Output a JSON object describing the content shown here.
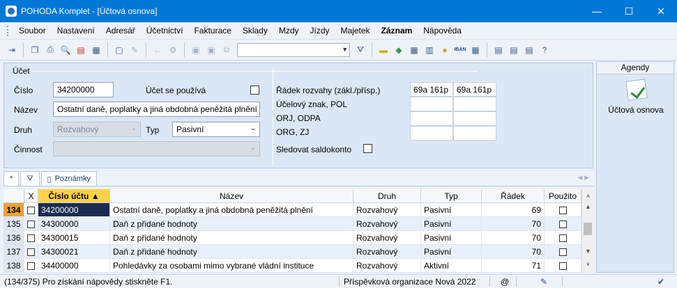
{
  "window": {
    "title": "POHODA Komplet - [Účtová osnova]",
    "minimize": "—",
    "maximize": "☐",
    "close": "✕"
  },
  "menu": [
    "Soubor",
    "Nastavení",
    "Adresář",
    "Účetnictví",
    "Fakturace",
    "Sklady",
    "Mzdy",
    "Jízdy",
    "Majetek",
    "Záznam",
    "Nápověda"
  ],
  "toolbar": {
    "iban_label": "IBAN"
  },
  "form": {
    "group_label": "Účet",
    "cislo_label": "Číslo",
    "cislo_value": "34200000",
    "pouziva_label": "Účet se používá",
    "nazev_label": "Název",
    "nazev_value": "Ostatní daně, poplatky a jiná obdobná peněžitá plnění",
    "druh_label": "Druh",
    "druh_value": "Rozvahový",
    "typ_label": "Typ",
    "typ_value": "Pasivní",
    "cinnost_label": "Činnost",
    "radek_label": "Řádek rozvahy (zákl./přísp.)",
    "radek_value1": "69a 161p",
    "radek_value2": "69a 161p",
    "ucelovy_label": "Účelový znak, POL",
    "orj_label": "ORJ, ODPA",
    "org_label": "ORG, ZJ",
    "saldo_label": "Sledovat saldokonto"
  },
  "agenda": {
    "header": "Agendy",
    "item_label": "Účtová osnova"
  },
  "tabs": {
    "star": "*",
    "filter_icon": "filter-icon",
    "notes": "Poznámky"
  },
  "table": {
    "columns": [
      "",
      "X",
      "Číslo účtu",
      "Název",
      "Druh",
      "Typ",
      "Řádek",
      "Použito"
    ],
    "rows": [
      {
        "n": "134",
        "cislo": "34200000",
        "nazev": "Ostatní daně, poplatky a jiná obdobná peněžitá plnění",
        "druh": "Rozvahový",
        "typ": "Pasivní",
        "radek": "69"
      },
      {
        "n": "135",
        "cislo": "34300000",
        "nazev": "Daň z přidané hodnoty",
        "druh": "Rozvahový",
        "typ": "Pasivní",
        "radek": "70"
      },
      {
        "n": "136",
        "cislo": "34300015",
        "nazev": "Daň z přidané hodnoty",
        "druh": "Rozvahový",
        "typ": "Pasivní",
        "radek": "70"
      },
      {
        "n": "137",
        "cislo": "34300021",
        "nazev": "Daň z přidané hodnoty",
        "druh": "Rozvahový",
        "typ": "Pasivní",
        "radek": "70"
      },
      {
        "n": "138",
        "cislo": "34400000",
        "nazev": "Pohledávky za osobami mimo vybrané vládní instituce",
        "druh": "Rozvahový",
        "typ": "Aktivní",
        "radek": "71"
      }
    ]
  },
  "status": {
    "left": "(134/375) Pro získání nápovědy stiskněte F1.",
    "org": "Příspěvková organizace Nová 2022",
    "at": "@"
  }
}
